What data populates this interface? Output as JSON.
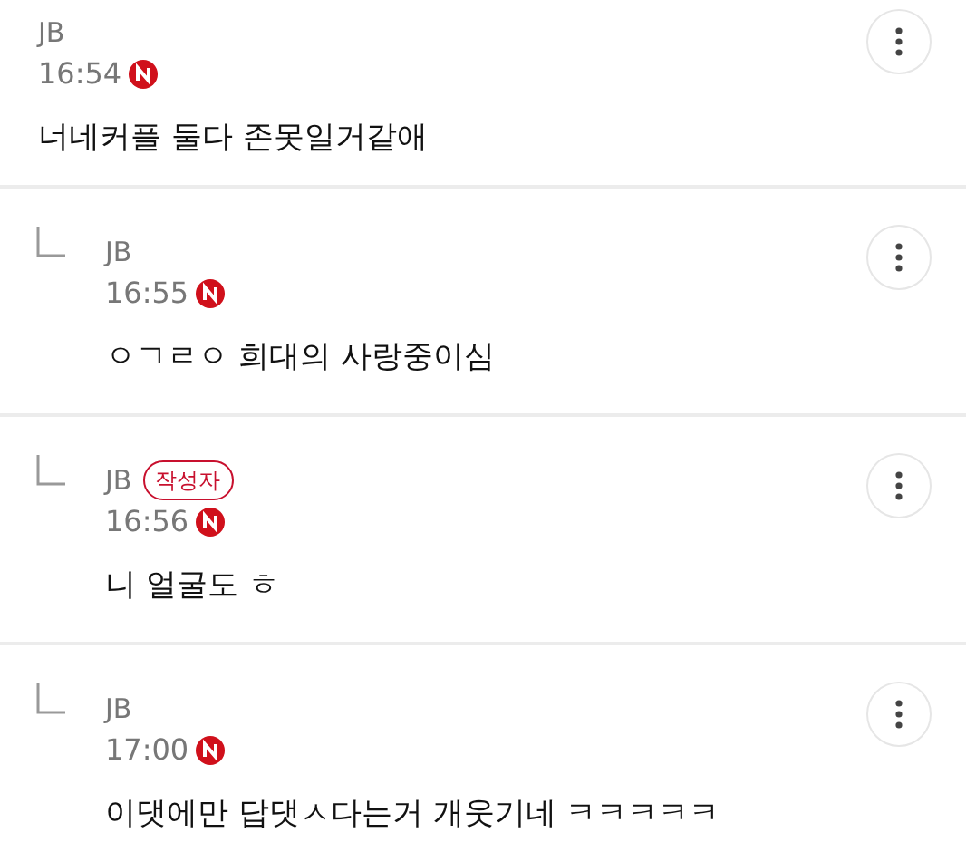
{
  "comments": [
    {
      "kind": "comment",
      "author": "JB",
      "time": "16:54",
      "new": true,
      "text": "너네커플 둘다 존못일거같애"
    },
    {
      "kind": "reply",
      "author": "JB",
      "time": "16:55",
      "new": true,
      "text": "ㅇㄱㄹㅇ 희대의 사랑중이심"
    },
    {
      "kind": "reply",
      "author": "JB",
      "author_badge": "작성자",
      "time": "16:56",
      "new": true,
      "text": "니 얼굴도 ㅎ"
    },
    {
      "kind": "reply",
      "author": "JB",
      "time": "17:00",
      "new": true,
      "text": "이댓에만 답댓ㅅ다는거 개웃기네 ㅋㅋㅋㅋㅋ"
    }
  ]
}
